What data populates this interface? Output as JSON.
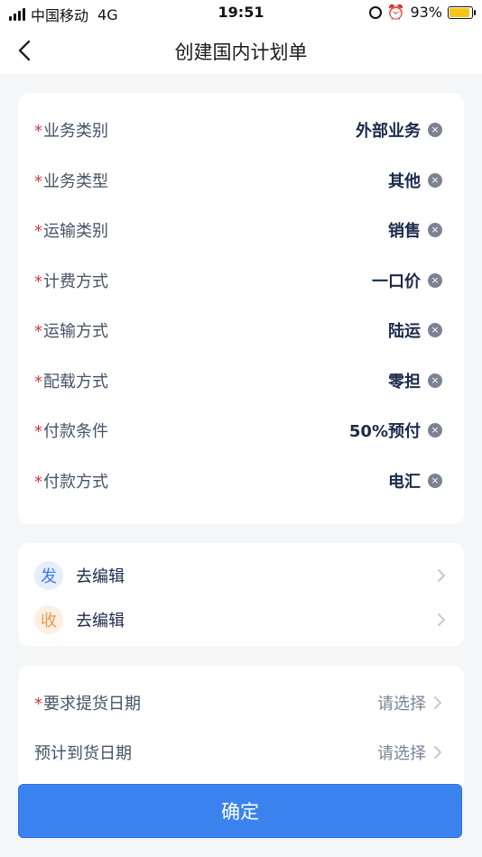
{
  "status_bar": {
    "carrier": "中国移动",
    "network": "4G",
    "time": "19:51",
    "battery": "93%"
  },
  "nav": {
    "title": "创建国内计划单"
  },
  "plan_fields": [
    {
      "label": "业务类别",
      "value": "外部业务"
    },
    {
      "label": "业务类型",
      "value": "其他"
    },
    {
      "label": "运输类别",
      "value": "销售"
    },
    {
      "label": "计费方式",
      "value": "一口价"
    },
    {
      "label": "运输方式",
      "value": "陆运"
    },
    {
      "label": "配载方式",
      "value": "零担"
    },
    {
      "label": "付款条件",
      "value": "50%预付"
    },
    {
      "label": "付款方式",
      "value": "电汇"
    }
  ],
  "required_mark": "*",
  "clear_glyph": "×",
  "parties": [
    {
      "badge": "发",
      "text": "去编辑"
    },
    {
      "badge": "收",
      "text": "去编辑"
    }
  ],
  "dates": [
    {
      "label": "要求提货日期",
      "required": true,
      "placeholder": "请选择"
    },
    {
      "label": "预计到货日期",
      "required": false,
      "placeholder": "请选择"
    }
  ],
  "confirm_label": "确定",
  "colors": {
    "primary": "#3a83ef",
    "required": "#d9363e",
    "send_badge": "#3a7bea",
    "receive_badge": "#e89a4c"
  }
}
